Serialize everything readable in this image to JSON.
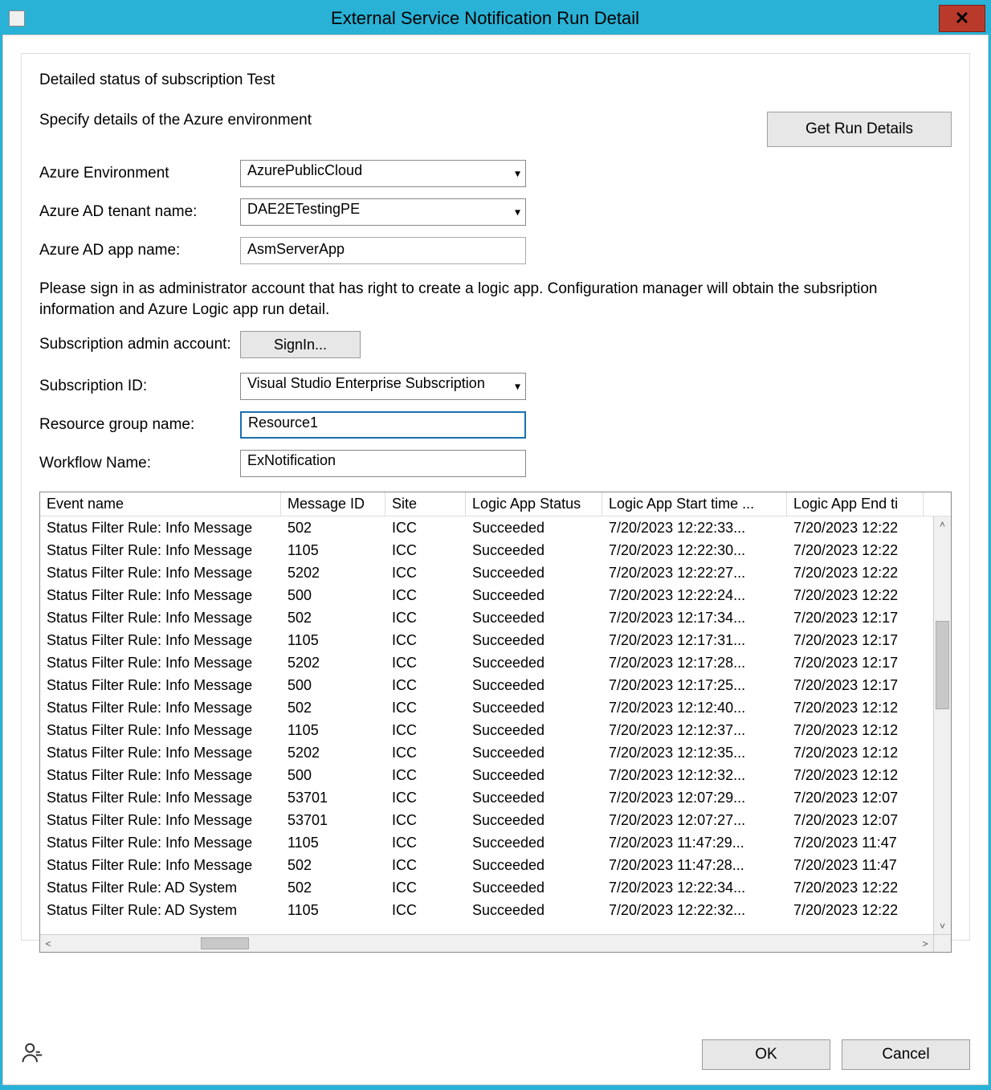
{
  "window": {
    "title": "External Service Notification Run Detail"
  },
  "panel": {
    "heading": "Detailed status of subscription Test",
    "azure_instruction": "Specify details of the Azure environment",
    "get_run_details_label": "Get Run Details",
    "labels": {
      "azure_env": "Azure Environment",
      "ad_tenant": "Azure AD tenant name:",
      "ad_app": "Azure AD app name:",
      "admin_account": "Subscription admin account:",
      "sub_id": "Subscription ID:",
      "rg_name": "Resource group name:",
      "wf_name": "Workflow Name:"
    },
    "values": {
      "azure_env": "AzurePublicCloud",
      "ad_tenant": "DAE2ETestingPE",
      "ad_app": "AsmServerApp",
      "sub_id": "Visual Studio Enterprise Subscription",
      "rg_name": "Resource1",
      "wf_name": "ExNotification"
    },
    "signin_instruction": "Please sign in as administrator account that has right to create a logic app. Configuration manager will obtain the subsription information and Azure Logic app run detail.",
    "signin_button": "SignIn..."
  },
  "table": {
    "columns": [
      "Event name",
      "Message ID",
      "Site",
      "Logic App Status",
      "Logic App Start time ...",
      "Logic App End ti"
    ],
    "rows": [
      {
        "event": "Status Filter Rule: Info Message",
        "msg": "502",
        "site": "ICC",
        "status": "Succeeded",
        "start": "7/20/2023 12:22:33...",
        "end": "7/20/2023 12:22"
      },
      {
        "event": "Status Filter Rule: Info Message",
        "msg": "1105",
        "site": "ICC",
        "status": "Succeeded",
        "start": "7/20/2023 12:22:30...",
        "end": "7/20/2023 12:22"
      },
      {
        "event": "Status Filter Rule: Info Message",
        "msg": "5202",
        "site": "ICC",
        "status": "Succeeded",
        "start": "7/20/2023 12:22:27...",
        "end": "7/20/2023 12:22"
      },
      {
        "event": "Status Filter Rule: Info Message",
        "msg": "500",
        "site": "ICC",
        "status": "Succeeded",
        "start": "7/20/2023 12:22:24...",
        "end": "7/20/2023 12:22"
      },
      {
        "event": "Status Filter Rule: Info Message",
        "msg": "502",
        "site": "ICC",
        "status": "Succeeded",
        "start": "7/20/2023 12:17:34...",
        "end": "7/20/2023 12:17"
      },
      {
        "event": "Status Filter Rule: Info Message",
        "msg": "1105",
        "site": "ICC",
        "status": "Succeeded",
        "start": "7/20/2023 12:17:31...",
        "end": "7/20/2023 12:17"
      },
      {
        "event": "Status Filter Rule: Info Message",
        "msg": "5202",
        "site": "ICC",
        "status": "Succeeded",
        "start": "7/20/2023 12:17:28...",
        "end": "7/20/2023 12:17"
      },
      {
        "event": "Status Filter Rule: Info Message",
        "msg": "500",
        "site": "ICC",
        "status": "Succeeded",
        "start": "7/20/2023 12:17:25...",
        "end": "7/20/2023 12:17"
      },
      {
        "event": "Status Filter Rule: Info Message",
        "msg": "502",
        "site": "ICC",
        "status": "Succeeded",
        "start": "7/20/2023 12:12:40...",
        "end": "7/20/2023 12:12"
      },
      {
        "event": "Status Filter Rule: Info Message",
        "msg": "1105",
        "site": "ICC",
        "status": "Succeeded",
        "start": "7/20/2023 12:12:37...",
        "end": "7/20/2023 12:12"
      },
      {
        "event": "Status Filter Rule: Info Message",
        "msg": "5202",
        "site": "ICC",
        "status": "Succeeded",
        "start": "7/20/2023 12:12:35...",
        "end": "7/20/2023 12:12"
      },
      {
        "event": "Status Filter Rule: Info Message",
        "msg": "500",
        "site": "ICC",
        "status": "Succeeded",
        "start": "7/20/2023 12:12:32...",
        "end": "7/20/2023 12:12"
      },
      {
        "event": "Status Filter Rule: Info Message",
        "msg": "53701",
        "site": "ICC",
        "status": "Succeeded",
        "start": "7/20/2023 12:07:29...",
        "end": "7/20/2023 12:07"
      },
      {
        "event": "Status Filter Rule: Info Message",
        "msg": "53701",
        "site": "ICC",
        "status": "Succeeded",
        "start": "7/20/2023 12:07:27...",
        "end": "7/20/2023 12:07"
      },
      {
        "event": "Status Filter Rule: Info Message",
        "msg": "1105",
        "site": "ICC",
        "status": "Succeeded",
        "start": "7/20/2023 11:47:29...",
        "end": "7/20/2023 11:47"
      },
      {
        "event": "Status Filter Rule: Info Message",
        "msg": "502",
        "site": "ICC",
        "status": "Succeeded",
        "start": "7/20/2023 11:47:28...",
        "end": "7/20/2023 11:47"
      },
      {
        "event": "Status Filter Rule: AD System",
        "msg": "502",
        "site": "ICC",
        "status": "Succeeded",
        "start": "7/20/2023 12:22:34...",
        "end": "7/20/2023 12:22"
      },
      {
        "event": "Status Filter Rule: AD System",
        "msg": "1105",
        "site": "ICC",
        "status": "Succeeded",
        "start": "7/20/2023 12:22:32...",
        "end": "7/20/2023 12:22"
      }
    ]
  },
  "footer": {
    "ok_label": "OK",
    "cancel_label": "Cancel"
  }
}
